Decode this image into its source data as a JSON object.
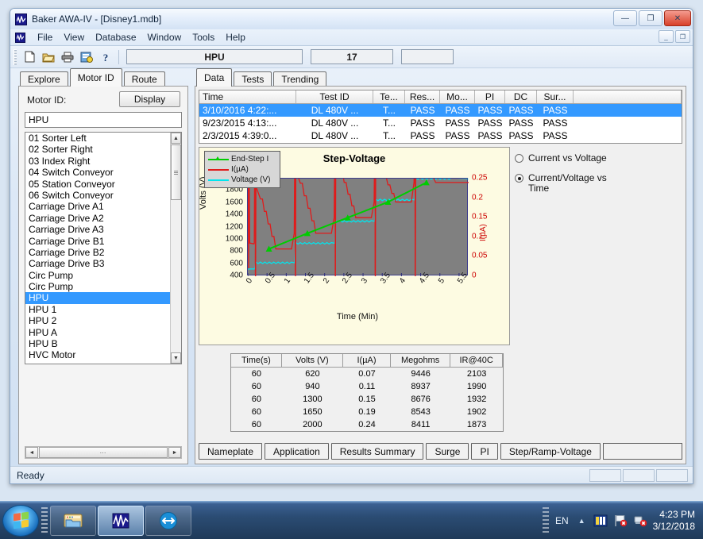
{
  "window": {
    "title": "Baker AWA-IV - [Disney1.mdb]",
    "minimize": "—",
    "restore": "❐",
    "close": "✕",
    "mdi_minimize": "_",
    "mdi_restore": "❐"
  },
  "menu": {
    "items": [
      "File",
      "View",
      "Database",
      "Window",
      "Tools",
      "Help"
    ]
  },
  "toolbar": {
    "buttons": [
      {
        "name": "new-icon",
        "glyph": "🗋"
      },
      {
        "name": "open-icon",
        "glyph": "📂"
      },
      {
        "name": "print-icon",
        "glyph": "🖶"
      },
      {
        "name": "report-icon",
        "glyph": "▤"
      },
      {
        "name": "help-icon",
        "glyph": "?"
      }
    ],
    "field_motor": "HPU",
    "field_count": "17",
    "field_extra": ""
  },
  "left_panel": {
    "tabs": [
      {
        "label": "Explore",
        "active": false
      },
      {
        "label": "Motor ID",
        "active": true
      },
      {
        "label": "Route",
        "active": false
      }
    ],
    "motor_id_label": "Motor ID:",
    "display_button": "Display",
    "motor_id_value": "HPU",
    "motor_list": [
      {
        "label": "01 Sorter Left",
        "selected": false
      },
      {
        "label": "02 Sorter Right",
        "selected": false
      },
      {
        "label": "03 Index Right",
        "selected": false
      },
      {
        "label": "04 Switch Conveyor",
        "selected": false
      },
      {
        "label": "05 Station Conveyor",
        "selected": false
      },
      {
        "label": "06 Switch Conveyor",
        "selected": false
      },
      {
        "label": "Carriage Drive A1",
        "selected": false
      },
      {
        "label": "Carriage Drive A2",
        "selected": false
      },
      {
        "label": "Carriage Drive A3",
        "selected": false
      },
      {
        "label": "Carriage Drive B1",
        "selected": false
      },
      {
        "label": "Carriage Drive B2",
        "selected": false
      },
      {
        "label": "Carriage Drive B3",
        "selected": false
      },
      {
        "label": "Circ Pump",
        "selected": false
      },
      {
        "label": "Circ Pump",
        "selected": false
      },
      {
        "label": "HPU",
        "selected": true
      },
      {
        "label": "HPU 1",
        "selected": false
      },
      {
        "label": "HPU 2",
        "selected": false
      },
      {
        "label": "HPU A",
        "selected": false
      },
      {
        "label": "HPU B",
        "selected": false
      },
      {
        "label": "HVC Motor",
        "selected": false
      }
    ],
    "scroll_up": "▲",
    "scroll_down": "▼",
    "hscroll_left": "◄",
    "hscroll_right": "►",
    "hscroll_grip": "⋯"
  },
  "right_panel": {
    "tabs": [
      {
        "label": "Data",
        "active": true
      },
      {
        "label": "Tests",
        "active": false
      },
      {
        "label": "Trending",
        "active": false
      }
    ],
    "grid": {
      "columns": [
        "Time",
        "Test ID",
        "Te...",
        "Res...",
        "Mo...",
        "PI",
        "DC",
        "Sur..."
      ],
      "rows": [
        {
          "selected": true,
          "cells": [
            "3/10/2016 4:22:...",
            "DL 480V ...",
            "T...",
            "PASS",
            "PASS",
            "PASS",
            "PASS",
            "PASS"
          ]
        },
        {
          "selected": false,
          "cells": [
            "9/23/2015 4:13:...",
            "DL 480V ...",
            "T...",
            "PASS",
            "PASS",
            "PASS",
            "PASS",
            "PASS"
          ]
        },
        {
          "selected": false,
          "cells": [
            "2/3/2015 4:39:0...",
            "DL 480V ...",
            "T...",
            "PASS",
            "PASS",
            "PASS",
            "PASS",
            "PASS"
          ]
        }
      ]
    },
    "view_options": [
      {
        "label": "Current vs Voltage",
        "selected": false
      },
      {
        "label": "Current/Voltage vs Time",
        "selected": true
      }
    ],
    "results_table": {
      "columns": [
        "Time(s)",
        "Volts (V)",
        "I(µA)",
        "Megohms",
        "IR@40C"
      ],
      "rows": [
        [
          "60",
          "620",
          "0.07",
          "9446",
          "2103"
        ],
        [
          "60",
          "940",
          "0.11",
          "8937",
          "1990"
        ],
        [
          "60",
          "1300",
          "0.15",
          "8676",
          "1932"
        ],
        [
          "60",
          "1650",
          "0.19",
          "8543",
          "1902"
        ],
        [
          "60",
          "2000",
          "0.24",
          "8411",
          "1873"
        ]
      ]
    },
    "bottom_tabs": [
      "Nameplate",
      "Application",
      "Results Summary",
      "Surge",
      "PI",
      "Step/Ramp-Voltage"
    ]
  },
  "chart_data": {
    "type": "line",
    "title": "Step-Voltage",
    "xlabel": "Time (Min)",
    "ylabel": "Volts (V)",
    "y2label": "I(µA)",
    "xlim": [
      0,
      5.75
    ],
    "ylim": [
      400,
      2000
    ],
    "y2lim": [
      0,
      0.25
    ],
    "grid": false,
    "plot_bg": "#808080",
    "panel_bg": "#fdfbe2",
    "legend_position": "top-left",
    "xticks": [
      "0",
      "0.5",
      "1",
      "1.5",
      "2",
      "2.5",
      "3",
      "3.5",
      "4",
      "4.5",
      "5",
      "5.5"
    ],
    "yticks": [
      "400",
      "600",
      "800",
      "1000",
      "1200",
      "1400",
      "1600",
      "1800",
      "2000"
    ],
    "y2ticks": [
      "0",
      "0.05",
      "0.1",
      "0.15",
      "0.2",
      "0.25"
    ],
    "series": [
      {
        "name": "End-Step I",
        "color": "#00cc00",
        "axis": "right",
        "points": [
          [
            0.55,
            0.07
          ],
          [
            1.55,
            0.11
          ],
          [
            2.6,
            0.15
          ],
          [
            3.65,
            0.19
          ],
          [
            4.65,
            0.24
          ]
        ]
      },
      {
        "name": "I(µA)",
        "color": "#e01b1b",
        "axis": "right",
        "description": "Charging current with spikes at each voltage step, decaying to end-step value"
      },
      {
        "name": "Voltage (V)",
        "color": "#00e5ee",
        "axis": "left",
        "steps": [
          620,
          940,
          1300,
          1650,
          2000
        ]
      }
    ]
  },
  "statusbar": {
    "text": "Ready"
  },
  "taskbar": {
    "tasks": [
      {
        "name": "explorer",
        "active": false
      },
      {
        "name": "baker-awa",
        "active": true
      },
      {
        "name": "teamviewer",
        "active": false
      }
    ],
    "language": "EN",
    "caret": "▲",
    "time": "4:23 PM",
    "date": "3/12/2018"
  }
}
